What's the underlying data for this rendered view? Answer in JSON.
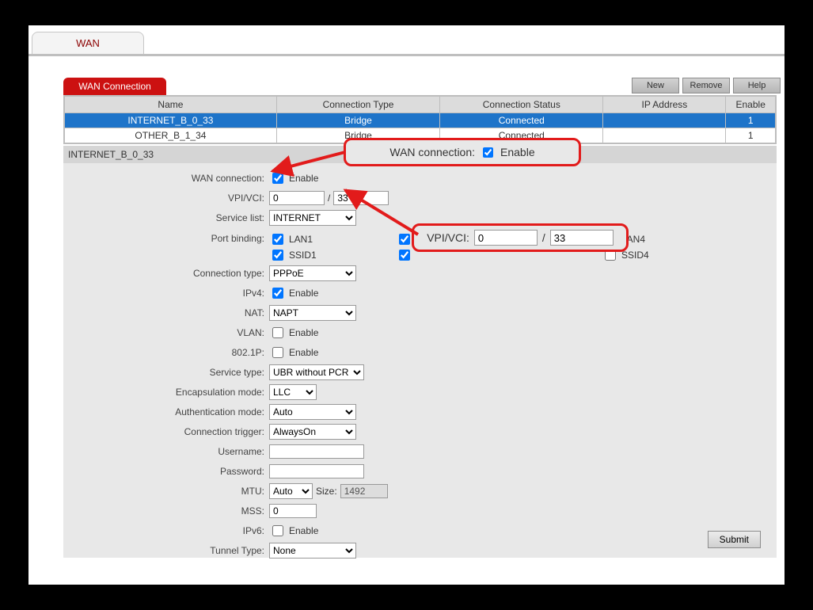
{
  "top_tab": "WAN",
  "section_tab": "WAN Connection",
  "buttons": {
    "new": "New",
    "remove": "Remove",
    "help": "Help",
    "submit": "Submit"
  },
  "table": {
    "headers": {
      "name": "Name",
      "type": "Connection Type",
      "status": "Connection Status",
      "ip": "IP Address",
      "enable": "Enable"
    },
    "rows": [
      {
        "name": "INTERNET_B_0_33",
        "type": "Bridge",
        "status": "Connected",
        "ip": "",
        "enable": "1",
        "selected": true
      },
      {
        "name": "OTHER_B_1_34",
        "type": "Bridge",
        "status": "Connected",
        "ip": "",
        "enable": "1",
        "selected": false
      }
    ]
  },
  "section_title": "INTERNET_B_0_33",
  "form": {
    "wan_connection": {
      "label": "WAN connection:",
      "text": "Enable",
      "checked": true
    },
    "vpi_vci": {
      "label": "VPI/VCI:",
      "vpi": "0",
      "sep": "/",
      "vci": "33"
    },
    "service_list": {
      "label": "Service list:",
      "value": "INTERNET"
    },
    "port_binding": {
      "label": "Port binding:",
      "col1": [
        "LAN1",
        "SSID1"
      ],
      "col2_checked": [
        true,
        true
      ],
      "col3": [
        "LAN4",
        "SSID4"
      ],
      "col1_checked": [
        true,
        true
      ],
      "col3_checked": [
        false,
        false
      ]
    },
    "connection_type": {
      "label": "Connection type:",
      "value": "PPPoE"
    },
    "ipv4": {
      "label": "IPv4:",
      "text": "Enable",
      "checked": true
    },
    "nat": {
      "label": "NAT:",
      "value": "NAPT"
    },
    "vlan": {
      "label": "VLAN:",
      "text": "Enable",
      "checked": false
    },
    "p8021": {
      "label": "802.1P:",
      "text": "Enable",
      "checked": false
    },
    "service_type": {
      "label": "Service type:",
      "value": "UBR without PCR"
    },
    "encap": {
      "label": "Encapsulation mode:",
      "value": "LLC"
    },
    "auth": {
      "label": "Authentication mode:",
      "value": "Auto"
    },
    "trigger": {
      "label": "Connection trigger:",
      "value": "AlwaysOn"
    },
    "username": {
      "label": "Username:",
      "value": ""
    },
    "password": {
      "label": "Password:",
      "value": ""
    },
    "mtu": {
      "label": "MTU:",
      "mode": "Auto",
      "size_label": "Size:",
      "size": "1492"
    },
    "mss": {
      "label": "MSS:",
      "value": "0"
    },
    "ipv6": {
      "label": "IPv6:",
      "text": "Enable",
      "checked": false
    },
    "tunnel": {
      "label": "Tunnel Type:",
      "value": "None"
    }
  },
  "callouts": {
    "c1": {
      "label": "WAN connection:",
      "text": "Enable",
      "checked": true
    },
    "c2": {
      "label": "VPI/VCI:",
      "vpi": "0",
      "sep": "/",
      "vci": "33"
    }
  }
}
